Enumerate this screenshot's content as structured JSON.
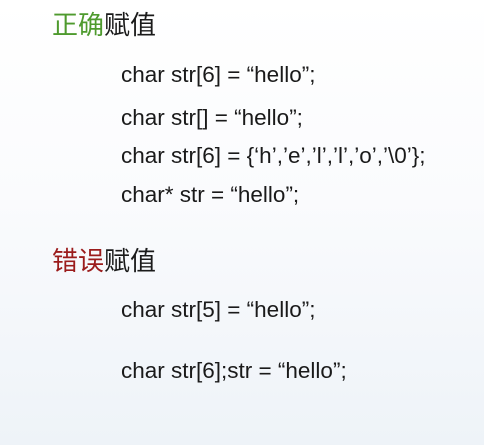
{
  "correct_section": {
    "heading_accent": "正确",
    "heading_rest": "赋值",
    "accent_color": "#4e9a2e",
    "lines": [
      "char str[6] = “hello”;",
      "char str[] = “hello”;",
      "char str[6] = {‘h’,’e’,’l’,’l’,’o’,’\\0’};",
      "char* str = “hello”;"
    ]
  },
  "wrong_section": {
    "heading_accent": "错误",
    "heading_rest": "赋值",
    "accent_color": "#9b1c1c",
    "lines": [
      "char str[5] = “hello”;",
      "char str[6];str = “hello”;"
    ]
  }
}
